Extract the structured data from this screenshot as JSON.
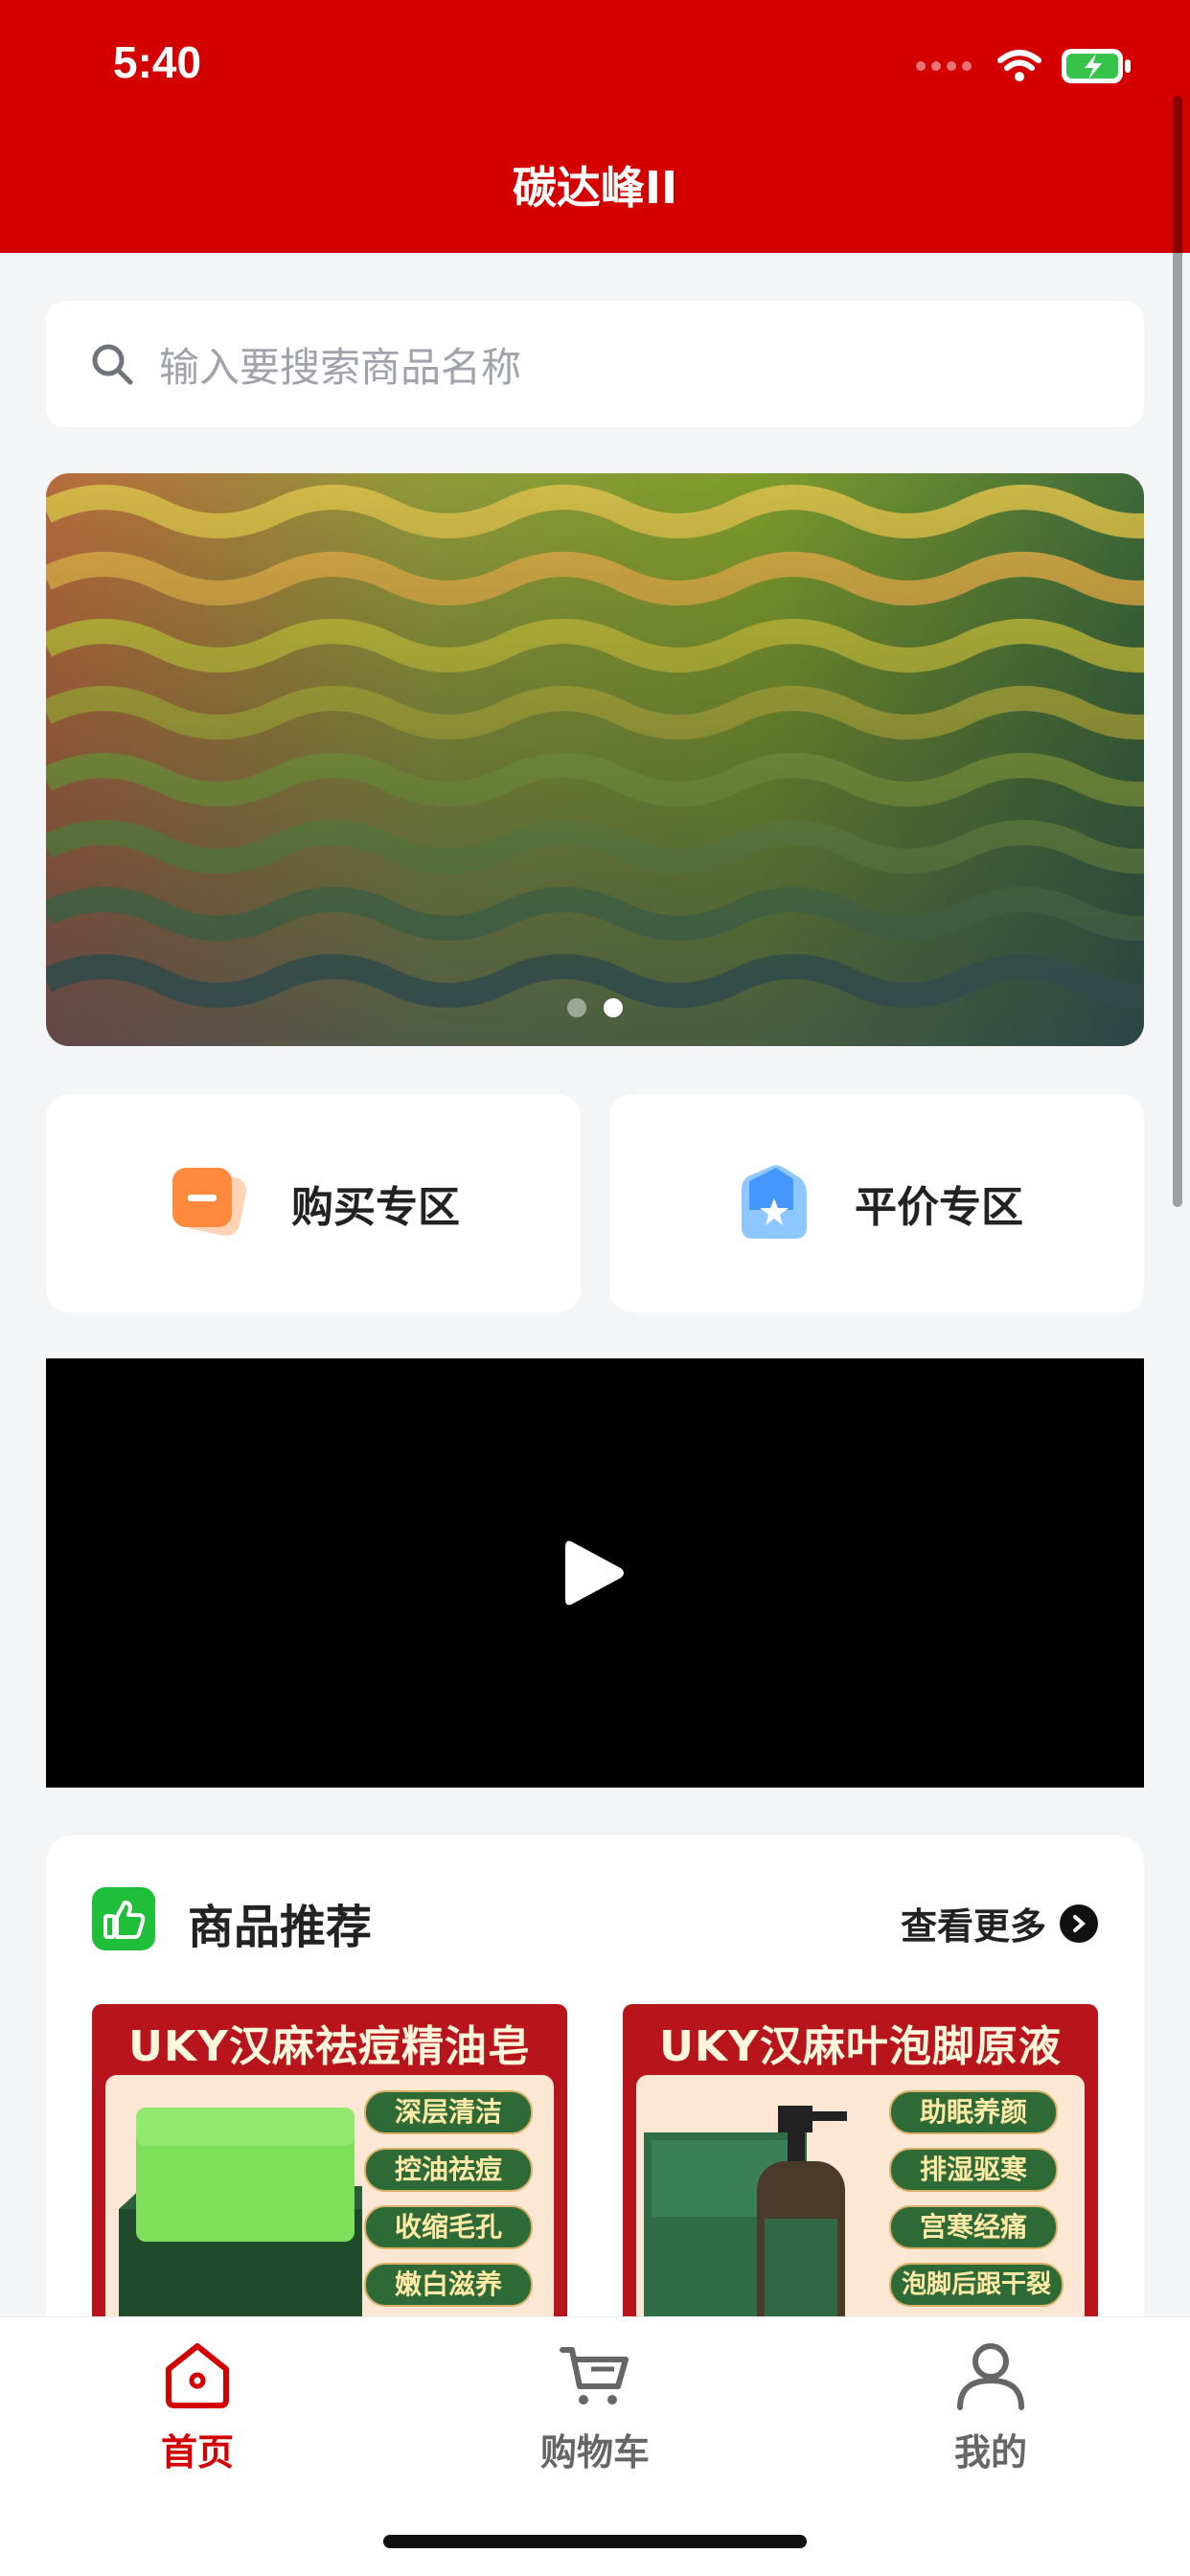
{
  "status_bar": {
    "time": "5:40"
  },
  "header": {
    "title": "碳达峰II"
  },
  "search": {
    "placeholder": "输入要搜索商品名称",
    "icon": "search-icon"
  },
  "banner": {
    "slide_count": 2,
    "active_index": 1
  },
  "zones": [
    {
      "label": "购买专区",
      "icon": "tag-icon"
    },
    {
      "label": "平价专区",
      "icon": "star-badge-icon"
    }
  ],
  "video": {
    "icon": "play-icon"
  },
  "recommend": {
    "title": "商品推荐",
    "more_label": "查看更多",
    "products": [
      {
        "title": "UKY汉麻祛痘精油皂",
        "tags": [
          "深层清洁",
          "控油祛痘",
          "收缩毛孔",
          "嫩白滋养"
        ]
      },
      {
        "title": "UKY汉麻叶泡脚原液",
        "tags": [
          "助眠养颜",
          "排湿驱寒",
          "宫寒经痛",
          "泡脚后跟干裂"
        ]
      }
    ]
  },
  "tabbar": {
    "items": [
      {
        "label": "首页",
        "icon": "home-icon",
        "active": true
      },
      {
        "label": "购物车",
        "icon": "cart-icon",
        "active": false
      },
      {
        "label": "我的",
        "icon": "user-icon",
        "active": false
      }
    ]
  },
  "colors": {
    "brand": "#d40000",
    "text": "#222222",
    "muted": "#a0a3ab",
    "inactive_tab": "#666666",
    "recommend_icon": "#1fbf3a"
  }
}
